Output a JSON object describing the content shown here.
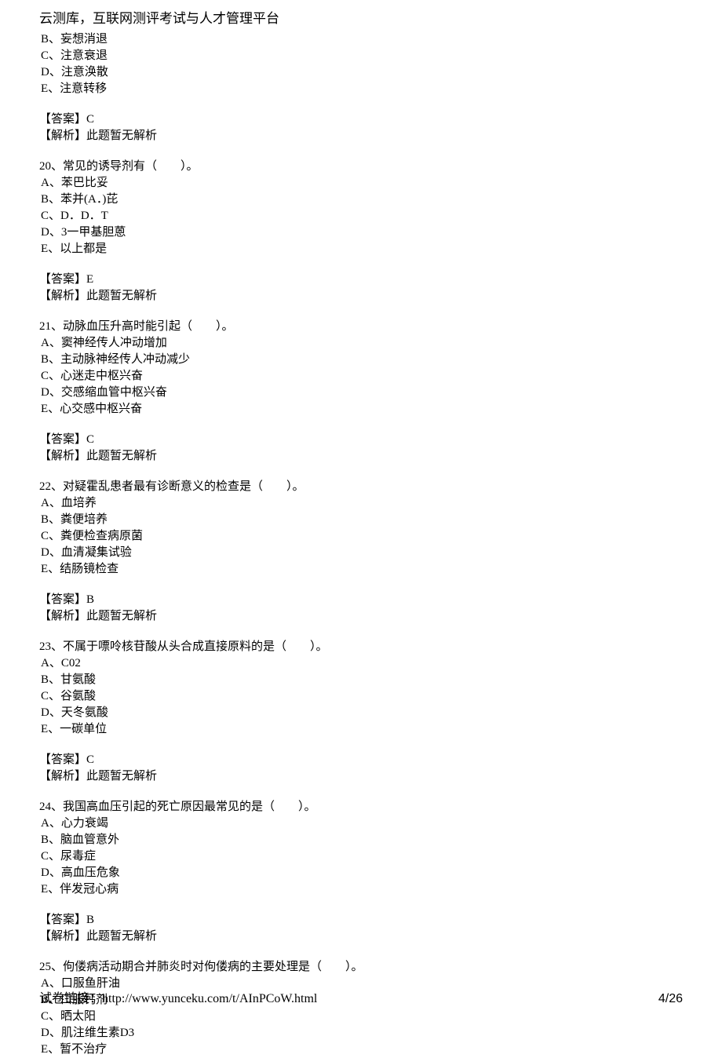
{
  "header": "云测库，互联网测评考试与人才管理平台",
  "partial_options": {
    "B": "B、妄想消退",
    "C": "C、注意衰退",
    "D": "D、注意涣散",
    "E": "E、注意转移"
  },
  "partial_answer": {
    "answer": "【答案】C",
    "analysis": "【解析】此题暂无解析"
  },
  "questions": [
    {
      "stem": "20、常见的诱导剂有（　　）。",
      "options": [
        "A、苯巴比妥",
        "B、苯并(A．)芘",
        "C、D．D．T",
        "D、3一甲基胆蒽",
        "E、以上都是"
      ],
      "answer": "【答案】E",
      "analysis": "【解析】此题暂无解析"
    },
    {
      "stem": "21、动脉血压升高时能引起（　　）。",
      "options": [
        "A、窦神经传人冲动增加",
        "B、主动脉神经传人冲动减少",
        "C、心迷走中枢兴奋",
        "D、交感缩血管中枢兴奋",
        "E、心交感中枢兴奋"
      ],
      "answer": "【答案】C",
      "analysis": "【解析】此题暂无解析"
    },
    {
      "stem": "22、对疑霍乱患者最有诊断意义的检查是（　　）。",
      "options": [
        "A、血培养",
        "B、粪便培养",
        "C、粪便检查病原菌",
        "D、血清凝集试验",
        "E、结肠镜检查"
      ],
      "answer": "【答案】B",
      "analysis": "【解析】此题暂无解析"
    },
    {
      "stem": "23、不属于嘌呤核苷酸从头合成直接原料的是（　　）。",
      "options": [
        "A、C02",
        "B、甘氨酸",
        "C、谷氨酸",
        "D、天冬氨酸",
        "E、一碳单位"
      ],
      "answer": "【答案】C",
      "analysis": "【解析】此题暂无解析"
    },
    {
      "stem": "24、我国高血压引起的死亡原因最常见的是（　　）。",
      "options": [
        "A、心力衰竭",
        "B、脑血管意外",
        "C、尿毒症",
        "D、高血压危象",
        "E、伴发冠心病"
      ],
      "answer": "【答案】B",
      "analysis": "【解析】此题暂无解析"
    },
    {
      "stem": "25、佝偻病活动期合并肺炎时对佝偻病的主要处理是（　　）。",
      "options": [
        "A、口服鱼肝油",
        "B、口服钙剂",
        "C、晒太阳",
        "D、肌注维生素D3",
        "E、暂不治疗"
      ],
      "answer": "",
      "analysis": ""
    }
  ],
  "footer_link": "试卷链接：http://www.yunceku.com/t/AInPCoW.html",
  "page_num": "4/26"
}
